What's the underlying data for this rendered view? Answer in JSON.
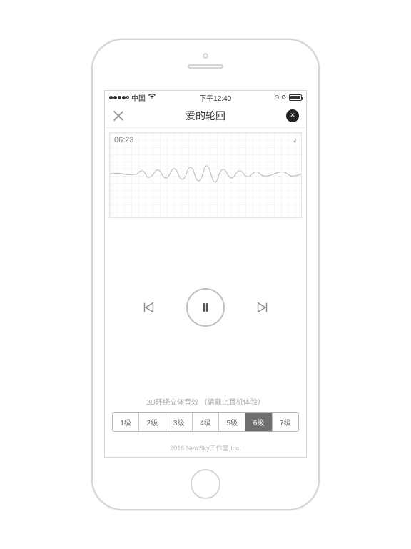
{
  "statusbar": {
    "carrier": "中国",
    "time": "下午12:40"
  },
  "nav": {
    "title": "爱的轮回"
  },
  "wave": {
    "time": "06:23",
    "note": "♪"
  },
  "eq": {
    "label": "3D环绕立体音效 （请戴上耳机体验）",
    "levels": [
      "1级",
      "2级",
      "3级",
      "4级",
      "5级",
      "6级",
      "7级"
    ],
    "active_index": 5
  },
  "footer": {
    "copyright": "2016 NewSky工作室 Inc."
  }
}
